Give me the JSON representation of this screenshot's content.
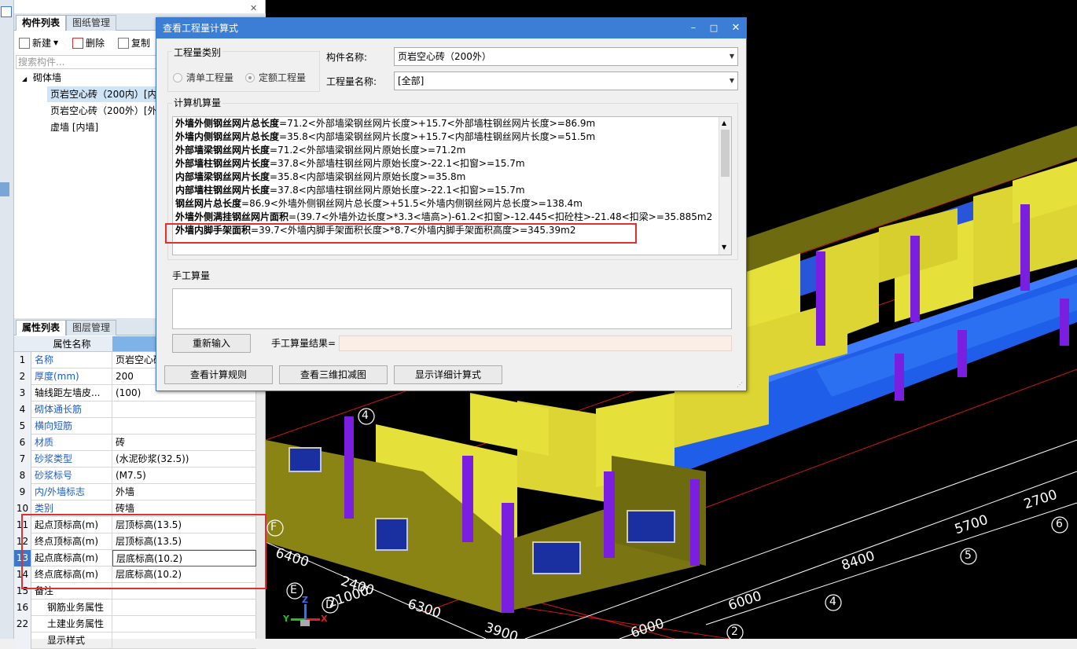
{
  "left_panel": {
    "tabs_top": [
      "构件列表",
      "图纸管理"
    ],
    "toolbar": {
      "new": "新建",
      "delete": "删除",
      "copy": "复制"
    },
    "search_placeholder": "搜索构件...",
    "tree": {
      "root": "砌体墙",
      "items": [
        "页岩空心砖（200内）[内",
        "页岩空心砖（200外）[外",
        "虚墙 [内墙]"
      ]
    },
    "tabs_bottom": [
      "属性列表",
      "图层管理"
    ],
    "attr_header": "属性名称",
    "attrs": [
      {
        "n": "1",
        "name": "名称",
        "val": "页岩空心砖",
        "blue": true
      },
      {
        "n": "2",
        "name": "厚度(mm)",
        "val": "200",
        "blue": true
      },
      {
        "n": "3",
        "name": "轴线距左墙皮...",
        "val": "(100)",
        "blue": false
      },
      {
        "n": "4",
        "name": "砌体通长筋",
        "val": "",
        "blue": true
      },
      {
        "n": "5",
        "name": "横向短筋",
        "val": "",
        "blue": true
      },
      {
        "n": "6",
        "name": "材质",
        "val": "砖",
        "blue": true
      },
      {
        "n": "7",
        "name": "砂浆类型",
        "val": "(水泥砂浆(32.5))",
        "blue": true
      },
      {
        "n": "8",
        "name": "砂浆标号",
        "val": "(M7.5)",
        "blue": true
      },
      {
        "n": "9",
        "name": "内/外墙标志",
        "val": "外墙",
        "blue": true
      },
      {
        "n": "10",
        "name": "类别",
        "val": "砖墙",
        "blue": true
      },
      {
        "n": "11",
        "name": "起点顶标高(m)",
        "val": "层顶标高(13.5)",
        "blue": false
      },
      {
        "n": "12",
        "name": "终点顶标高(m)",
        "val": "层顶标高(13.5)",
        "blue": false
      },
      {
        "n": "13",
        "name": "起点底标高(m)",
        "val": "层底标高(10.2)",
        "blue": false
      },
      {
        "n": "14",
        "name": "终点底标高(m)",
        "val": "层底标高(10.2)",
        "blue": false
      },
      {
        "n": "15",
        "name": "备注",
        "val": "",
        "blue": false
      },
      {
        "n": "16",
        "name": "钢筋业务属性",
        "val": "",
        "blue": false
      },
      {
        "n": "22",
        "name": "土建业务属性",
        "val": "",
        "blue": false
      },
      {
        "n": "",
        "name": "显示样式",
        "val": "",
        "blue": false
      }
    ]
  },
  "dialog": {
    "title": "查看工程量计算式",
    "qty_type_label": "工程量类别",
    "radio1": "清单工程量",
    "radio2": "定额工程量",
    "comp_name_label": "构件名称:",
    "comp_name_value": "页岩空心砖（200外）",
    "qty_name_label": "工程量名称:",
    "qty_name_value": "[全部]",
    "machine_label": "计算机算量",
    "lines": [
      {
        "b": "外墙外侧钢丝网片总长度",
        "t": "=71.2<外部墙梁钢丝网片长度>+15.7<外部墙柱钢丝网片长度>=86.9m"
      },
      {
        "b": "外墙内侧钢丝网片总长度",
        "t": "=35.8<内部墙梁钢丝网片长度>+15.7<内部墙柱钢丝网片长度>=51.5m"
      },
      {
        "b": "外部墙梁钢丝网片长度",
        "t": "=71.2<外部墙梁钢丝网片原始长度>=71.2m"
      },
      {
        "b": "外部墙柱钢丝网片长度",
        "t": "=37.8<外部墙柱钢丝网片原始长度>-22.1<扣窗>=15.7m"
      },
      {
        "b": "内部墙梁钢丝网片长度",
        "t": "=35.8<内部墙梁钢丝网片原始长度>=35.8m"
      },
      {
        "b": "内部墙柱钢丝网片长度",
        "t": "=37.8<内部墙柱钢丝网片原始长度>-22.1<扣窗>=15.7m"
      },
      {
        "b": "钢丝网片总长度",
        "t": "=86.9<外墙外侧钢丝网片总长度>+51.5<外墙内侧钢丝网片总长度>=138.4m"
      },
      {
        "b": "外墙外侧满挂钢丝网片面积",
        "t": "=(39.7<外墙外边长度>*3.3<墙高>)-61.2<扣窗>-12.445<扣砼柱>-21.48<扣梁>=35.885m2"
      },
      {
        "b": "外墙内脚手架面积",
        "t": "=39.7<外墙内脚手架面积长度>*8.7<外墙内脚手架面积高度>=345.39m2"
      }
    ],
    "manual_label": "手工算量",
    "reinput": "重新输入",
    "manual_result_label": "手工算量结果=",
    "btn_rules": "查看计算规则",
    "btn_3d": "查看三维扣减图",
    "btn_detail": "显示详细计算式"
  },
  "scene": {
    "dims": [
      "6400",
      "2400",
      "21000",
      "6300",
      "3900",
      "6000",
      "6000",
      "8400",
      "5700",
      "2700"
    ],
    "axes": [
      "4",
      "E",
      "D",
      "F",
      "2",
      "4",
      "5",
      "6"
    ],
    "gizmo": [
      "Z",
      "Y",
      "X"
    ]
  }
}
